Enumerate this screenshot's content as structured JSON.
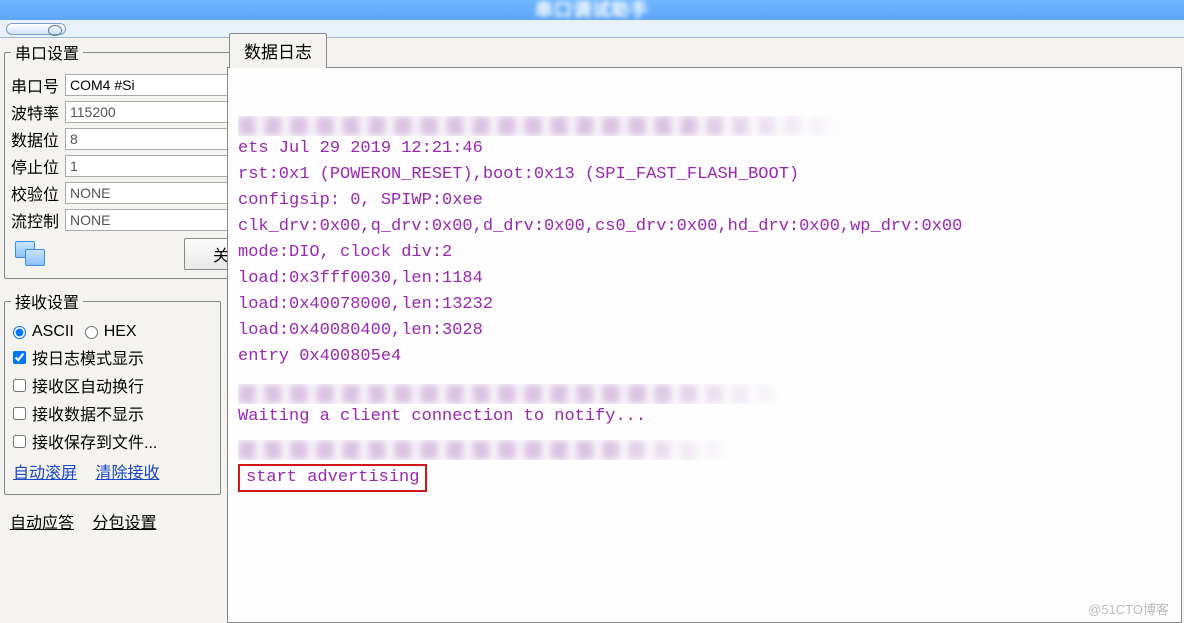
{
  "app_title": "串口调试助手",
  "sidebar": {
    "port_settings": {
      "legend": "串口设置",
      "rows": {
        "port": {
          "label": "串口号",
          "value": "COM4 #Si"
        },
        "baud": {
          "label": "波特率",
          "value": "115200"
        },
        "databits": {
          "label": "数据位",
          "value": "8"
        },
        "stopbits": {
          "label": "停止位",
          "value": "1"
        },
        "parity": {
          "label": "校验位",
          "value": "NONE"
        },
        "flow": {
          "label": "流控制",
          "value": "NONE"
        }
      },
      "close_button": "关闭"
    },
    "recv_settings": {
      "legend": "接收设置",
      "ascii_label": "ASCII",
      "hex_label": "HEX",
      "ascii_selected": true,
      "opts": {
        "log_mode": {
          "label": "按日志模式显示",
          "checked": true
        },
        "auto_wrap": {
          "label": "接收区自动换行",
          "checked": false
        },
        "hide_recv": {
          "label": "接收数据不显示",
          "checked": false
        },
        "save_file": {
          "label": "接收保存到文件...",
          "checked": false
        }
      },
      "links": {
        "auto_scroll": "自动滚屏",
        "clear_recv": "清除接收"
      }
    },
    "bottom_buttons": {
      "auto_reply": "自动应答",
      "packet": "分包设置"
    }
  },
  "log": {
    "tab": "数据日志",
    "lines": [
      "ets Jul 29 2019 12:21:46",
      "",
      "rst:0x1 (POWERON_RESET),boot:0x13 (SPI_FAST_FLASH_BOOT)",
      "configsip: 0, SPIWP:0xee",
      "clk_drv:0x00,q_drv:0x00,d_drv:0x00,cs0_drv:0x00,hd_drv:0x00,wp_drv:0x00",
      "mode:DIO, clock div:2",
      "load:0x3fff0030,len:1184",
      "load:0x40078000,len:13232",
      "load:0x40080400,len:3028",
      "entry 0x400805e4"
    ],
    "waiting": "Waiting a client connection to notify...",
    "advertising": "start advertising"
  },
  "watermark": "@51CTO博客"
}
